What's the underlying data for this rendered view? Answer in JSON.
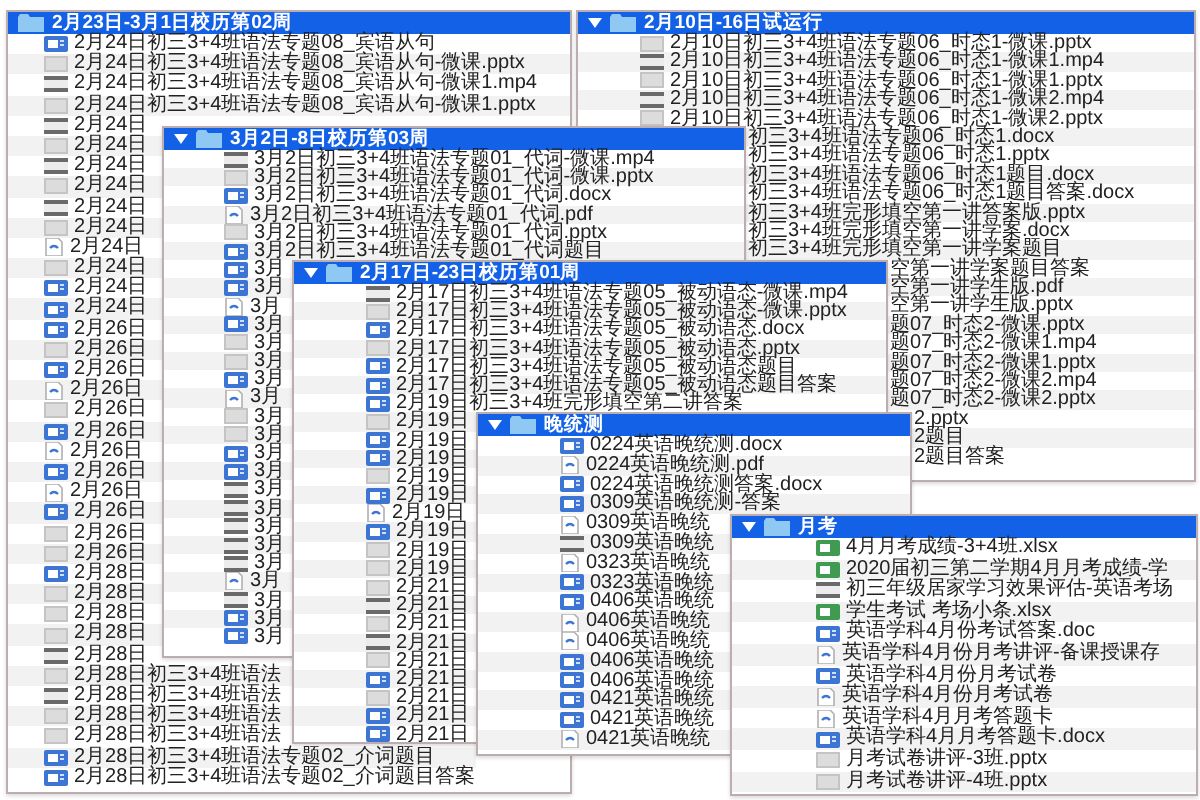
{
  "folders": [
    {
      "title": "2月23日-3月1日校历第02周",
      "disclosure": false,
      "rows": [
        {
          "kind": "doc",
          "name": "2月24日初三3+4班语法专题08_宾语从句"
        },
        {
          "kind": "pptx",
          "name": "2月24日初三3+4班语法专题08_宾语从句-微课.pptx"
        },
        {
          "kind": "mp4",
          "name": "2月24日初三3+4班语法专题08_宾语从句-微课1.mp4"
        },
        {
          "kind": "pptx",
          "name": "2月24日初三3+4班语法专题08_宾语从句-微课1.pptx"
        },
        {
          "kind": "mp4",
          "name": "2月24日"
        },
        {
          "kind": "pptx",
          "name": "2月24日"
        },
        {
          "kind": "mp4",
          "name": "2月24日"
        },
        {
          "kind": "pptx",
          "name": "2月24日"
        },
        {
          "kind": "mp4",
          "name": "2月24日"
        },
        {
          "kind": "pptx",
          "name": "2月24日"
        },
        {
          "kind": "pdf",
          "name": "2月24日"
        },
        {
          "kind": "pptx",
          "name": "2月24日"
        },
        {
          "kind": "doc",
          "name": "2月24日"
        },
        {
          "kind": "doc",
          "name": "2月24日"
        },
        {
          "kind": "doc",
          "name": "2月26日"
        },
        {
          "kind": "pptx",
          "name": "2月26日"
        },
        {
          "kind": "doc",
          "name": "2月26日"
        },
        {
          "kind": "pdf",
          "name": "2月26日"
        },
        {
          "kind": "pptx",
          "name": "2月26日"
        },
        {
          "kind": "doc",
          "name": "2月26日"
        },
        {
          "kind": "pdf",
          "name": "2月26日"
        },
        {
          "kind": "doc",
          "name": "2月26日"
        },
        {
          "kind": "pdf",
          "name": "2月26日"
        },
        {
          "kind": "doc",
          "name": "2月26日"
        },
        {
          "kind": "pptx",
          "name": "2月26日"
        },
        {
          "kind": "pptx",
          "name": "2月26日"
        },
        {
          "kind": "doc",
          "name": "2月28日"
        },
        {
          "kind": "pptx",
          "name": "2月28日"
        },
        {
          "kind": "pptx",
          "name": "2月28日"
        },
        {
          "kind": "pptx",
          "name": "2月28日"
        },
        {
          "kind": "mp4",
          "name": "2月28日"
        },
        {
          "kind": "pptx",
          "name": "2月28日初三3+4班语法"
        },
        {
          "kind": "mp4",
          "name": "2月28日初三3+4班语法"
        },
        {
          "kind": "pptx",
          "name": "2月28日初三3+4班语法"
        },
        {
          "kind": "pptx",
          "name": "2月28日初三3+4班语法"
        },
        {
          "kind": "doc",
          "name": "2月28日初三3+4班语法专题02_介词题目"
        },
        {
          "kind": "doc",
          "name": "2月28日初三3+4班语法专题02_介词题目答案"
        }
      ]
    },
    {
      "title": "2月10日-16日试运行",
      "disclosure": true,
      "rows": [
        {
          "kind": "pptx",
          "covered": false,
          "name": "2月10日初三3+4班语法专题06_时态1-微课.pptx"
        },
        {
          "kind": "mp4",
          "covered": false,
          "name": "2月10日初三3+4班语法专题06_时态1-微课1.mp4"
        },
        {
          "kind": "pptx",
          "covered": false,
          "name": "2月10日初三3+4班语法专题06_时态1-微课1.pptx"
        },
        {
          "kind": "mp4",
          "covered": false,
          "name": "2月10日初三3+4班语法专题06_时态1-微课2.mp4"
        },
        {
          "kind": "pptx",
          "covered": false,
          "name": "2月10日初三3+4班语法专题06_时态1-微课2.pptx"
        },
        {
          "covered": true,
          "name": "初三3+4班语法专题06_时态1.docx"
        },
        {
          "covered": true,
          "name": "初三3+4班语法专题06_时态1.pptx"
        },
        {
          "covered": true,
          "name": "初三3+4班语法专题06_时态1题目.docx"
        },
        {
          "covered": true,
          "name": "初三3+4班语法专题06_时态1题目答案.docx"
        },
        {
          "covered": true,
          "name": "初三3+4班完形填空第一讲答案版.pptx"
        },
        {
          "covered": true,
          "name": "初三3+4班完形填空第一讲学案.docx"
        },
        {
          "covered": true,
          "name": "初三3+4班完形填空第一讲学案题目"
        },
        {
          "covered": true,
          "name": "空第一讲学案题目答案"
        },
        {
          "covered": true,
          "name": "空第一讲学生版.pdf"
        },
        {
          "covered": true,
          "name": "空第一讲学生版.pptx"
        },
        {
          "covered": true,
          "name": "题07_时态2-微课.pptx"
        },
        {
          "covered": true,
          "name": "题07_时态2-微课1.mp4"
        },
        {
          "covered": true,
          "name": "题07_时态2-微课1.pptx"
        },
        {
          "covered": true,
          "name": "题07_时态2-微课2.mp4"
        },
        {
          "covered": true,
          "name": "题07_时态2-微课2.pptx"
        },
        {
          "covered": true,
          "name": "2.pptx"
        },
        {
          "covered": true,
          "name": "2题目"
        },
        {
          "covered": true,
          "name": "2题目答案"
        }
      ]
    },
    {
      "title": "3月2日-8日校历第03周",
      "disclosure": true,
      "rows": [
        {
          "kind": "mp4",
          "name": "3月2日初三3+4班语法专题01_代词-微课.mp4"
        },
        {
          "kind": "pptx",
          "name": "3月2日初三3+4班语法专题01_代词-微课.pptx"
        },
        {
          "kind": "doc",
          "name": "3月2日初三3+4班语法专题01_代词.docx"
        },
        {
          "kind": "pdf",
          "name": "3月2日初三3+4班语法专题01_代词.pdf"
        },
        {
          "kind": "pptx",
          "name": "3月2日初三3+4班语法专题01_代词.pptx"
        },
        {
          "kind": "doc",
          "name": "3月2日初三3+4班语法专题01_代词题目"
        },
        {
          "kind": "doc",
          "name": "3月"
        },
        {
          "kind": "doc",
          "name": "3月"
        },
        {
          "kind": "pdf",
          "name": "3月"
        },
        {
          "kind": "doc",
          "name": "3月"
        },
        {
          "kind": "pptx",
          "name": "3月"
        },
        {
          "kind": "pptx",
          "name": "3月"
        },
        {
          "kind": "doc",
          "name": "3月"
        },
        {
          "kind": "pdf",
          "name": "3月"
        },
        {
          "kind": "pptx",
          "name": "3月"
        },
        {
          "kind": "pptx",
          "name": "3月"
        },
        {
          "kind": "doc",
          "name": "3月"
        },
        {
          "kind": "doc",
          "name": "3月"
        },
        {
          "kind": "mp4",
          "name": "3月"
        },
        {
          "kind": "mp4",
          "name": "3月"
        },
        {
          "kind": "mp4",
          "name": "3月"
        },
        {
          "kind": "mp4",
          "name": "3月"
        },
        {
          "kind": "mp4",
          "name": "3月"
        },
        {
          "kind": "pdf",
          "name": "3月"
        },
        {
          "kind": "mp4",
          "name": "3月"
        },
        {
          "kind": "doc",
          "name": "3月"
        },
        {
          "kind": "doc",
          "name": "3月"
        }
      ]
    },
    {
      "title": "2月17日-23日校历第01周",
      "disclosure": true,
      "rows": [
        {
          "kind": "mp4",
          "name": "2月17日初三3+4班语法专题05_被动语态-微课.mp4"
        },
        {
          "kind": "pptx",
          "name": "2月17日初三3+4班语法专题05_被动语态-微课.pptx"
        },
        {
          "kind": "doc",
          "name": "2月17日初三3+4班语法专题05_被动语态.docx"
        },
        {
          "kind": "pptx",
          "name": "2月17日初三3+4班语法专题05_被动语态.pptx"
        },
        {
          "kind": "doc",
          "name": "2月17日初三3+4班语法专题05_被动语态题目"
        },
        {
          "kind": "doc",
          "name": "2月17日初三3+4班语法专题05_被动语态题目答案"
        },
        {
          "kind": "doc",
          "name": "2月19日初三3+4班完形填空第二讲答案"
        },
        {
          "kind": "pptx",
          "name": "2月19日"
        },
        {
          "kind": "doc",
          "name": "2月19日"
        },
        {
          "kind": "doc",
          "name": "2月19日"
        },
        {
          "kind": "pptx",
          "name": "2月19日"
        },
        {
          "kind": "doc",
          "name": "2月19日"
        },
        {
          "kind": "pdf",
          "name": "2月19日"
        },
        {
          "kind": "doc",
          "name": "2月19日"
        },
        {
          "kind": "pptx",
          "name": "2月19日"
        },
        {
          "kind": "pptx",
          "name": "2月19日"
        },
        {
          "kind": "pptx",
          "name": "2月21日"
        },
        {
          "kind": "mp4",
          "name": "2月21日"
        },
        {
          "kind": "pptx",
          "name": "2月21日"
        },
        {
          "kind": "mp4",
          "name": "2月21日"
        },
        {
          "kind": "pptx",
          "name": "2月21日"
        },
        {
          "kind": "doc",
          "name": "2月21日"
        },
        {
          "kind": "pptx",
          "name": "2月21日"
        },
        {
          "kind": "doc",
          "name": "2月21日"
        },
        {
          "kind": "doc",
          "name": "2月21日"
        }
      ]
    },
    {
      "title": "晚统测",
      "disclosure": true,
      "rows": [
        {
          "kind": "doc",
          "name": "0224英语晚统测.docx"
        },
        {
          "kind": "pdf",
          "name": "0224英语晚统测.pdf"
        },
        {
          "kind": "doc",
          "name": "0224英语晚统测答案.docx"
        },
        {
          "kind": "doc",
          "name": "0309英语晚统测-答案"
        },
        {
          "kind": "pdf",
          "name": "0309英语晚统"
        },
        {
          "kind": "mp4",
          "name": "0309英语晚统"
        },
        {
          "kind": "pdf",
          "name": "0323英语晚统"
        },
        {
          "kind": "doc",
          "name": "0323英语晚统"
        },
        {
          "kind": "doc",
          "name": "0406英语晚统"
        },
        {
          "kind": "pdf",
          "name": "0406英语晚统"
        },
        {
          "kind": "pdf",
          "name": "0406英语晚统"
        },
        {
          "kind": "doc",
          "name": "0406英语晚统"
        },
        {
          "kind": "doc",
          "name": "0406英语晚统"
        },
        {
          "kind": "doc",
          "name": "0421英语晚统"
        },
        {
          "kind": "doc",
          "name": "0421英语晚统"
        },
        {
          "kind": "pdf",
          "name": "0421英语晚统"
        }
      ]
    },
    {
      "title": "月考",
      "disclosure": true,
      "rows": [
        {
          "kind": "xlsx",
          "name": "4月月考成绩-3+4班.xlsx"
        },
        {
          "kind": "xlsx",
          "name": "2020届初三第二学期4月月考成绩-学"
        },
        {
          "kind": "mp4",
          "name": "初三年级居家学习效果评估-英语考场"
        },
        {
          "kind": "xlsx",
          "name": "学生考试 考场小条.xlsx"
        },
        {
          "kind": "doc",
          "name": "英语学科4月份考试答案.doc"
        },
        {
          "kind": "pdf",
          "name": "英语学科4月份月考讲评-备课授课存"
        },
        {
          "kind": "doc",
          "name": "英语学科4月份月考试卷"
        },
        {
          "kind": "pdf",
          "name": "英语学科4月份月考试卷"
        },
        {
          "kind": "pdf",
          "name": "英语学科4月月考答题卡"
        },
        {
          "kind": "doc",
          "name": "英语学科4月月考答题卡.docx"
        },
        {
          "kind": "pptx",
          "name": "月考试卷讲评-3班.pptx"
        },
        {
          "kind": "pptx",
          "name": "月考试卷讲评-4班.pptx"
        }
      ]
    }
  ]
}
